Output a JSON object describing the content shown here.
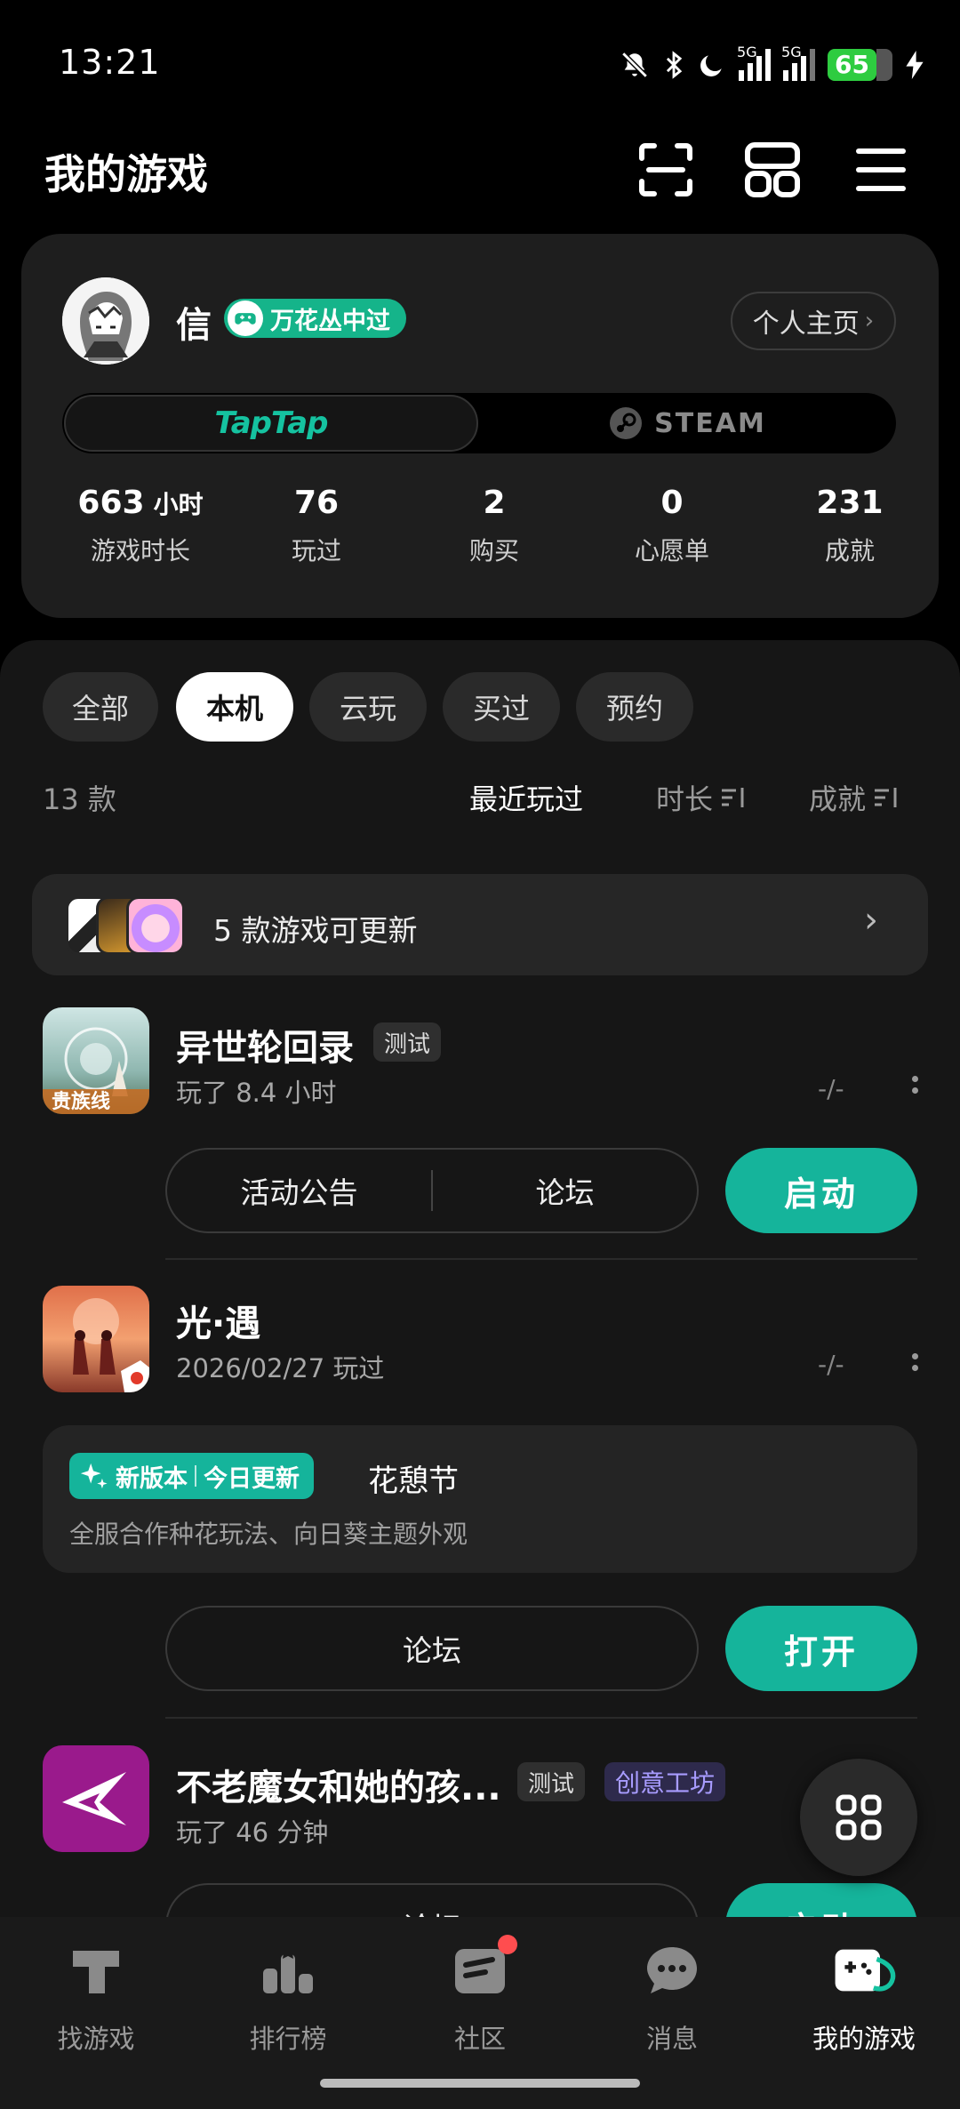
{
  "status_bar": {
    "time": "13:21",
    "battery": "65",
    "net1": "5G",
    "net2": "5G"
  },
  "header": {
    "title": "我的游戏"
  },
  "profile": {
    "username": "信",
    "badge": "万花丛中过",
    "home_button": "个人主页",
    "platform_taptap": "TapTap",
    "platform_steam": "STEAM",
    "stats": [
      {
        "value": "663",
        "unit": "小时",
        "label": "游戏时长"
      },
      {
        "value": "76",
        "unit": "",
        "label": "玩过"
      },
      {
        "value": "2",
        "unit": "",
        "label": "购买"
      },
      {
        "value": "0",
        "unit": "",
        "label": "心愿单"
      },
      {
        "value": "231",
        "unit": "",
        "label": "成就"
      }
    ]
  },
  "filters": {
    "tabs": [
      "全部",
      "本机",
      "云玩",
      "买过",
      "预约"
    ],
    "active": "本机",
    "count": "13 款",
    "sort_options": [
      "最近玩过",
      "时长",
      "成就"
    ]
  },
  "update_bar": {
    "text": "5 款游戏可更新"
  },
  "games": [
    {
      "name": "异世轮回录",
      "tag": "测试",
      "subtitle": "玩了 8.4 小时",
      "score": "-/-",
      "actions": [
        "活动公告",
        "论坛"
      ],
      "primary": "启动",
      "icon_text": "贵族线"
    },
    {
      "name": "光·遇",
      "subtitle": "2026/02/27 玩过",
      "score": "-/-",
      "news": {
        "tag_a": "新版本",
        "tag_b": "今日更新",
        "title": "花憩节",
        "desc": "全服合作种花玩法、向日葵主题外观"
      },
      "actions": [
        "论坛"
      ],
      "primary": "打开"
    },
    {
      "name": "不老魔女和她的孩...",
      "tag": "测试",
      "tag2": "创意工坊",
      "subtitle": "玩了 46 分钟",
      "actions": [
        "论坛"
      ],
      "primary": "启动"
    }
  ],
  "bottom_nav": [
    {
      "label": "找游戏",
      "icon": "tap-icon"
    },
    {
      "label": "排行榜",
      "icon": "ranking-icon"
    },
    {
      "label": "社区",
      "icon": "community-icon"
    },
    {
      "label": "消息",
      "icon": "message-icon"
    },
    {
      "label": "我的游戏",
      "icon": "my-games-icon",
      "active": true
    }
  ],
  "colors": {
    "accent": "#15b49b",
    "background": "#000000",
    "card": "#1e1e1e"
  }
}
